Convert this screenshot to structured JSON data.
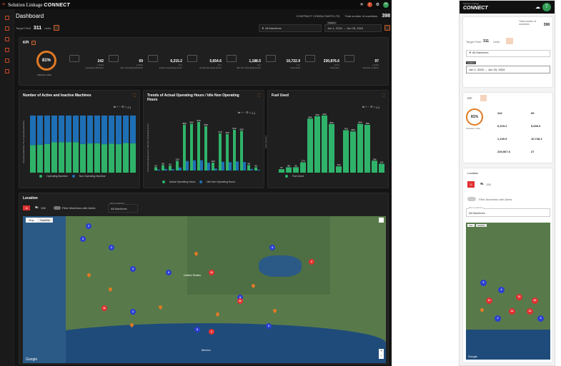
{
  "app": {
    "brand_text": "Solution Linkage",
    "brand_bold": "CONNECT",
    "notif_count": "2",
    "user_initial": "H"
  },
  "header": {
    "title": "Dashboard",
    "company": "CONTRACT CONSULTANTS LTD.",
    "total_label": "Total number of machines",
    "total_value": "398"
  },
  "controls": {
    "target_label": "Target Field",
    "target_value": "311",
    "target_unit": "Units",
    "machine_select": "All Machines",
    "date_label": "Custom",
    "date_range": "Jun 1, 2024 → Jun 15, 2024"
  },
  "kpi": {
    "title": "KPI",
    "utilization": "81%",
    "utilization_label": "Utilization Rate",
    "items": [
      {
        "value": "242",
        "sub": "[ Unit ]",
        "label": "Operating Machine"
      },
      {
        "value": "69",
        "sub": "[ Unit ]",
        "label": "Non Operating Machine"
      },
      {
        "value": "6,215.2",
        "sub": "[ h ]",
        "label": "Engine Operating Hours"
      },
      {
        "value": "5,654.6",
        "sub": "[ h ]",
        "label": "Actual Operating Hours"
      },
      {
        "value": "1,188.5",
        "sub": "[ h ]",
        "label": "Idle Non Operating Hours"
      },
      {
        "value": "10,722.9",
        "sub": "[ L ]",
        "label": "Fuel Used"
      },
      {
        "value": "230,876.6",
        "sub": "[ km ]",
        "label": "Odometer"
      },
      {
        "value": "97",
        "sub": "[ Unit ]",
        "label": "Number of Alerts"
      }
    ]
  },
  "charts": {
    "machines": {
      "title": "Number of Active and Inactive Machines",
      "ylabel": "Operating Machine / Non Operating Machine",
      "legend_a": "Operating Machine",
      "legend_b": "Non Operating Machine"
    },
    "hours": {
      "title": "Trends of Actual Operating Hours / Idle Non Operating Hours",
      "ylabel": "Actual Operating Hours / Idle Non Operating Hours",
      "legend_a": "Actual Operating Hours",
      "legend_b": "Idle Non Operating Hours"
    },
    "fuel": {
      "title": "Fuel Used",
      "ylabel": "Fuel Used (L)",
      "legend_a": "Fuel Used"
    }
  },
  "chart_data": [
    {
      "type": "bar",
      "title": "Number of Active and Inactive Machines",
      "series": [
        {
          "name": "Operating Machine",
          "values": [
            150,
            152,
            156,
            165,
            166,
            165,
            166,
            156,
            159,
            160,
            155,
            158,
            155,
            161,
            160
          ]
        },
        {
          "name": "Non Operating Machine",
          "values": [
            161,
            159,
            155,
            146,
            145,
            146,
            145,
            155,
            152,
            151,
            156,
            153,
            156,
            150,
            151
          ]
        }
      ]
    },
    {
      "type": "bar",
      "title": "Trends of Actual Operating Hours / Idle Non Operating Hours",
      "series": [
        {
          "name": "Actual Operating Hours",
          "values": [
            42,
            68,
            60,
            120,
            580,
            590,
            615,
            560,
            100,
            470,
            460,
            515,
            500,
            68,
            40
          ]
        },
        {
          "name": "Idle Non Operating Hours",
          "values": [
            12,
            20,
            16,
            38,
            120,
            128,
            130,
            98,
            25,
            110,
            105,
            115,
            108,
            20,
            10
          ]
        }
      ]
    },
    {
      "type": "bar",
      "title": "Fuel Used",
      "series": [
        {
          "name": "Fuel Used",
          "values": [
            57,
            88,
            90,
            170,
            890,
            930,
            943,
            802,
            104,
            700,
            680,
            804,
            789,
            196,
            147
          ]
        }
      ]
    }
  ],
  "location": {
    "title": "Location",
    "alerts_count": "11",
    "machines_count": "158",
    "filter_label": "Filter Machines with Alerts",
    "filter_by": "Filter by Machines",
    "filter_value": "All Machines",
    "tab_map": "Map",
    "tab_sat": "Satellite",
    "google": "Google",
    "country": "United States",
    "mexico": "Mexico"
  },
  "mobile": {
    "brand": "CONNECT",
    "brand_small": "Solution Linkage",
    "avatar": "T",
    "total_label": "Total number of machines",
    "total_value": "398",
    "target_label": "Target Field",
    "target_value": "311",
    "target_unit": "Units",
    "machine_select": "All Machines",
    "date_tag": "Custom",
    "date_range": "Jun 1, 2024 → Jun 15, 2024",
    "kpi_title": "KPI",
    "util": "81%",
    "util_label": "Utilization Rate",
    "kvals": [
      "242",
      "69",
      "6,215.2",
      "5,636.6",
      "1,130.9",
      "10,728.2",
      "230,967.6",
      "27"
    ],
    "loc_title": "Location",
    "loc_alerts": "11",
    "loc_machines": "158",
    "loc_filter": "Filter Machines with Alerts",
    "loc_by": "Filter by Machines",
    "loc_value": "All Machines",
    "tab_map": "Map",
    "tab_sat": "Satellite",
    "google": "Google"
  }
}
